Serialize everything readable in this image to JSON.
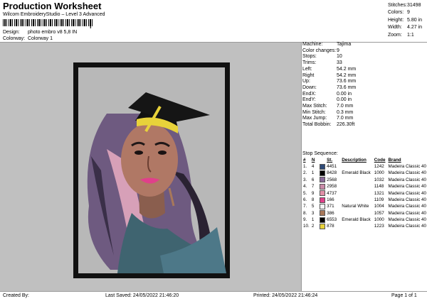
{
  "header": {
    "title": "Production Worksheet",
    "subtitle": "Wilcom EmbroideryStudio – Level 3 Advanced",
    "barcode_tail": "|"
  },
  "meta": [
    {
      "key": "Design:",
      "value": "photo embro v8 5,8 IN"
    },
    {
      "key": "Colorway:",
      "value": "Colorway 1"
    }
  ],
  "top_stats": [
    {
      "key": "Stitches:",
      "value": "31498"
    },
    {
      "key": "Colors:",
      "value": "9"
    },
    {
      "key": "Height:",
      "value": "5.80 in"
    },
    {
      "key": "Width:",
      "value": "4.27 in"
    },
    {
      "key": "Zoom:",
      "value": "1:1"
    }
  ],
  "machine_info": [
    {
      "key": "Machine:",
      "value": "Tajima"
    },
    {
      "key": "Color changes:",
      "value": "9"
    },
    {
      "key": "Stops:",
      "value": "10"
    },
    {
      "key": "Trims:",
      "value": "33"
    },
    {
      "key": "Left:",
      "value": "54.2 mm"
    },
    {
      "key": "Right",
      "value": "54.2 mm"
    },
    {
      "key": "Up:",
      "value": "73.6 mm"
    },
    {
      "key": "Down:",
      "value": "73.6 mm"
    },
    {
      "key": "EndX:",
      "value": "0.00 in"
    },
    {
      "key": "EndY:",
      "value": "0.00 in"
    },
    {
      "key": "Max Stitch:",
      "value": "7.0 mm"
    },
    {
      "key": "Min Stitch:",
      "value": "0.3 mm"
    },
    {
      "key": "Max Jump:",
      "value": "7.0 mm"
    },
    {
      "key": "Total Bobbin:",
      "value": "226.30ft"
    }
  ],
  "stop_sequence": {
    "label": "Stop Sequence:",
    "columns": [
      "#",
      "N",
      "St.",
      "Description",
      "Code",
      "Brand"
    ],
    "rows": [
      {
        "num": "1.",
        "n": "4",
        "color": "#2e4a78",
        "st": "4451",
        "desc": "",
        "code": "1242",
        "brand": "Madeira Classic 40"
      },
      {
        "num": "2.",
        "n": "1",
        "color": "#000000",
        "st": "8428",
        "desc": "Emerald Black",
        "code": "1000",
        "brand": "Madeira Classic 40"
      },
      {
        "num": "3.",
        "n": "6",
        "color": "#8a6a9a",
        "st": "2568",
        "desc": "",
        "code": "1032",
        "brand": "Madeira Classic 40"
      },
      {
        "num": "4.",
        "n": "7",
        "color": "#c98aa8",
        "st": "2958",
        "desc": "",
        "code": "1148",
        "brand": "Madeira Classic 40"
      },
      {
        "num": "5.",
        "n": "9",
        "color": "#e090a8",
        "st": "4737",
        "desc": "",
        "code": "1321",
        "brand": "Madeira Classic 40"
      },
      {
        "num": "6.",
        "n": "8",
        "color": "#e0408a",
        "st": "166",
        "desc": "",
        "code": "1109",
        "brand": "Madeira Classic 40"
      },
      {
        "num": "7.",
        "n": "5",
        "color": "#f2f2f2",
        "st": "371",
        "desc": "Natural White",
        "code": "1004",
        "brand": "Madeira Classic 40"
      },
      {
        "num": "8.",
        "n": "3",
        "color": "#a8785a",
        "st": "386",
        "desc": "",
        "code": "1057",
        "brand": "Madeira Classic 40"
      },
      {
        "num": "9.",
        "n": "1",
        "color": "#000000",
        "st": "6553",
        "desc": "Emerald Black",
        "code": "1000",
        "brand": "Madeira Classic 40"
      },
      {
        "num": "10.",
        "n": "2",
        "color": "#e8d23a",
        "st": "878",
        "desc": "",
        "code": "1223",
        "brand": "Madeira Classic 40"
      }
    ]
  },
  "footer": {
    "created": "Created By:",
    "saved": "Last Saved: 24/05/2022 21:46:20",
    "printed": "Printed: 24/05/2022 21:46:24",
    "page": "Page 1 of 1"
  }
}
